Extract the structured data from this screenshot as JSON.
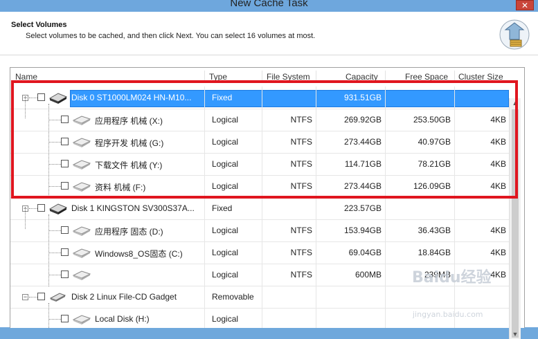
{
  "window": {
    "title": "New Cache Task",
    "close_glyph": "✕"
  },
  "header": {
    "title": "Select Volumes",
    "subtitle": "Select volumes to be cached, and then click Next. You can select 16 volumes at most.",
    "icon": "cache-wizard-icon"
  },
  "columns": [
    "Name",
    "Type",
    "File System",
    "Capacity",
    "Free Space",
    "Cluster Size"
  ],
  "rows": [
    {
      "level": 0,
      "name": "Disk 0 ST1000LM024 HN-M10...",
      "type": "Fixed",
      "fs": "",
      "capacity": "931.51GB",
      "free": "",
      "cluster": "",
      "selected": true,
      "icon": "hard-disk-icon"
    },
    {
      "level": 1,
      "name": "应用程序 机械 (X:)",
      "type": "Logical",
      "fs": "NTFS",
      "capacity": "269.92GB",
      "free": "253.50GB",
      "cluster": "4KB",
      "icon": "volume-icon"
    },
    {
      "level": 1,
      "name": "程序开发 机械 (G:)",
      "type": "Logical",
      "fs": "NTFS",
      "capacity": "273.44GB",
      "free": "40.97GB",
      "cluster": "4KB",
      "icon": "volume-icon"
    },
    {
      "level": 1,
      "name": "下载文件 机械 (Y:)",
      "type": "Logical",
      "fs": "NTFS",
      "capacity": "114.71GB",
      "free": "78.21GB",
      "cluster": "4KB",
      "icon": "volume-icon"
    },
    {
      "level": 1,
      "name": "资料 机械 (F:)",
      "type": "Logical",
      "fs": "NTFS",
      "capacity": "273.44GB",
      "free": "126.09GB",
      "cluster": "4KB",
      "icon": "volume-icon"
    },
    {
      "level": 0,
      "name": "Disk 1 KINGSTON SV300S37A...",
      "type": "Fixed",
      "fs": "",
      "capacity": "223.57GB",
      "free": "",
      "cluster": "",
      "icon": "hard-disk-icon"
    },
    {
      "level": 1,
      "name": "应用程序 固态 (D:)",
      "type": "Logical",
      "fs": "NTFS",
      "capacity": "153.94GB",
      "free": "36.43GB",
      "cluster": "4KB",
      "icon": "volume-icon"
    },
    {
      "level": 1,
      "name": "Windows8_OS固态 (C:)",
      "type": "Logical",
      "fs": "NTFS",
      "capacity": "69.04GB",
      "free": "18.84GB",
      "cluster": "4KB",
      "icon": "volume-icon"
    },
    {
      "level": 1,
      "name": "",
      "type": "Logical",
      "fs": "NTFS",
      "capacity": "600MB",
      "free": "239MB",
      "cluster": "4KB",
      "icon": "volume-icon"
    },
    {
      "level": 0,
      "name": "Disk 2 Linux   File-CD Gadget",
      "type": "Removable",
      "fs": "",
      "capacity": "",
      "free": "",
      "cluster": "",
      "icon": "usb-drive-icon"
    },
    {
      "level": 1,
      "name": "Local Disk (H:)",
      "type": "Logical",
      "fs": "",
      "capacity": "",
      "free": "",
      "cluster": "",
      "icon": "volume-icon"
    }
  ],
  "watermark": {
    "logo": "Baidu经验",
    "site": "jingyan.baidu.com"
  },
  "colors": {
    "selection": "#3399ff",
    "highlight_box": "#e0161f",
    "titlebar": "#6ea7dd"
  }
}
